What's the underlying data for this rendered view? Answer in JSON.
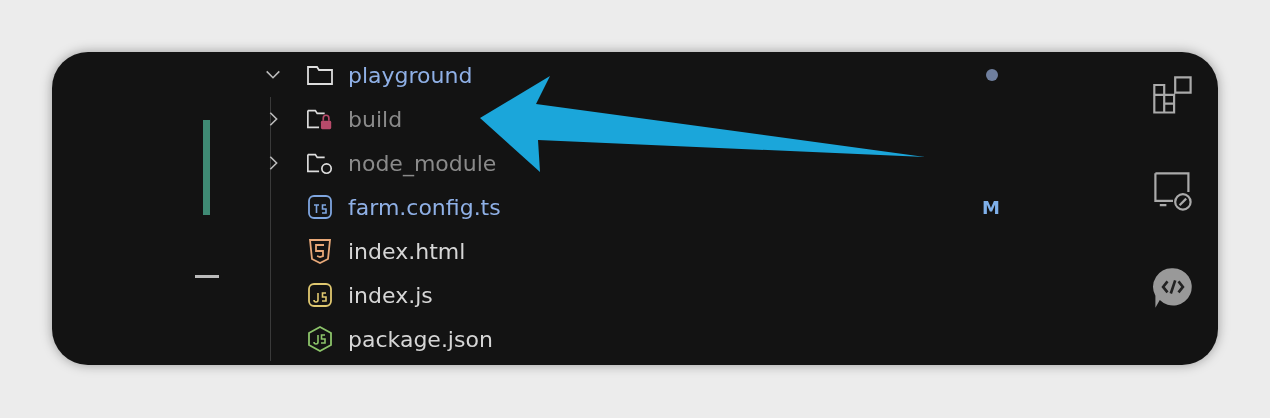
{
  "explorer": {
    "items": [
      {
        "name": "playground",
        "kind": "folder",
        "expanded": true,
        "dimmed": false,
        "modified": true,
        "dot": true,
        "children": [
          {
            "name": "build",
            "kind": "folder-lock",
            "expanded": false,
            "dimmed": true,
            "modified": false
          },
          {
            "name": "node_module",
            "kind": "folder-sync",
            "expanded": false,
            "dimmed": true,
            "modified": false
          },
          {
            "name": "farm.config.ts",
            "kind": "ts",
            "dimmed": false,
            "modified": true,
            "badge": "M"
          },
          {
            "name": "index.html",
            "kind": "html",
            "dimmed": false,
            "modified": false
          },
          {
            "name": "index.js",
            "kind": "js",
            "dimmed": false,
            "modified": false
          },
          {
            "name": "package.json",
            "kind": "node",
            "dimmed": false,
            "modified": false
          }
        ]
      }
    ]
  }
}
